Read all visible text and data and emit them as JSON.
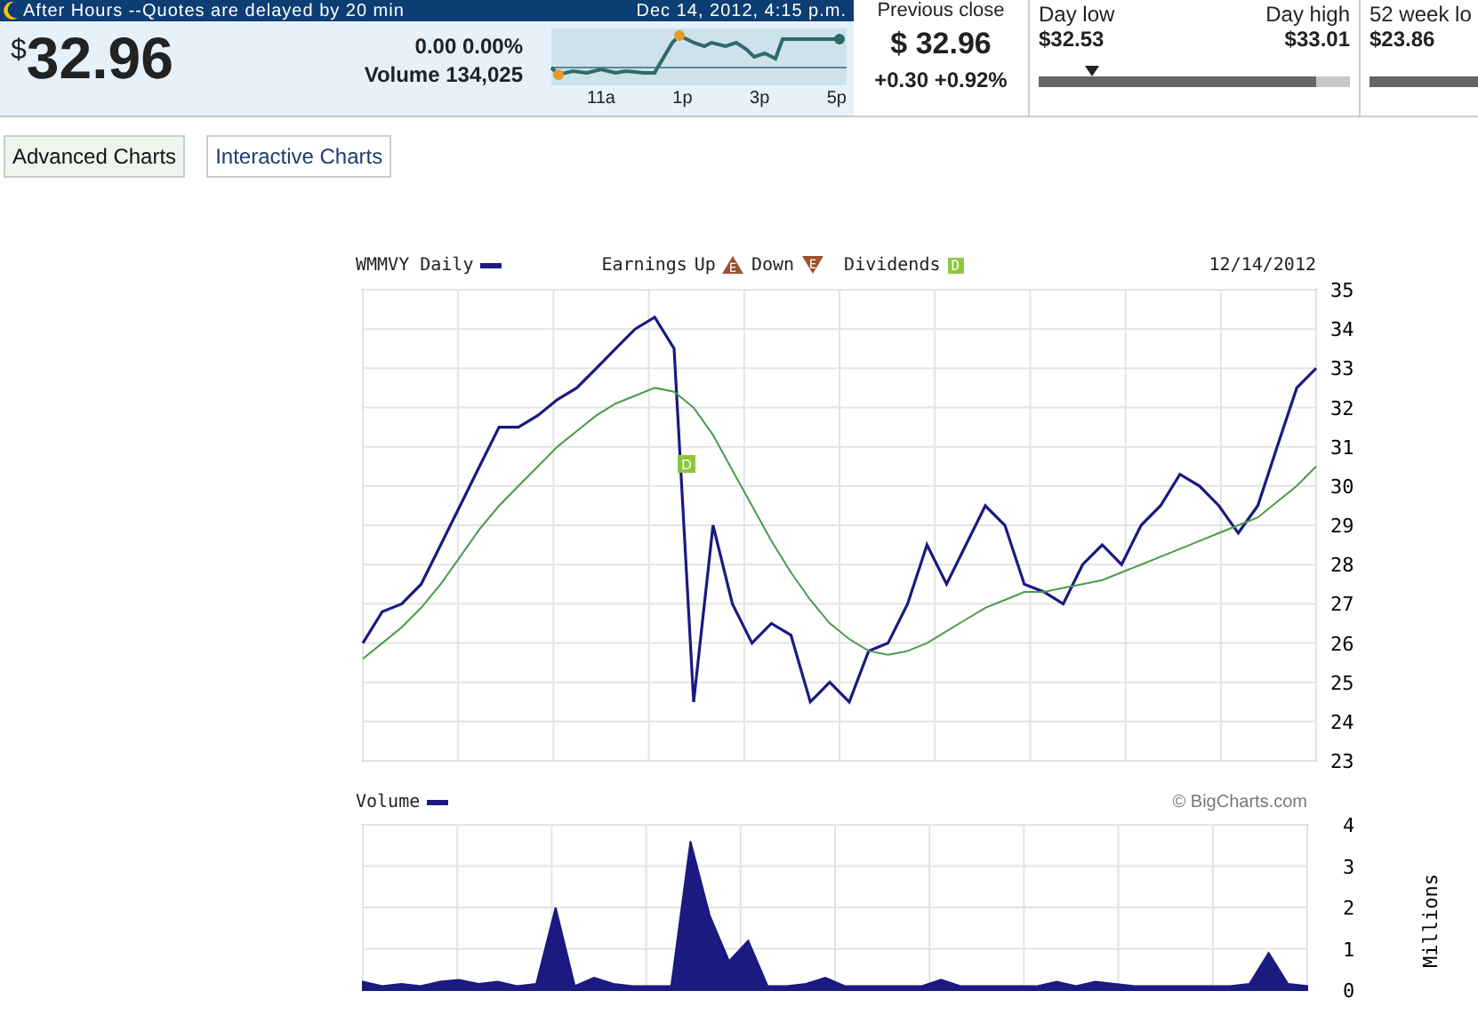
{
  "quote_header": {
    "notice": "After Hours --Quotes are delayed by 20 min",
    "timestamp": "Dec 14, 2012, 4:15 p.m.",
    "price_symbol": "$",
    "price": "32.96",
    "change": "0.00 0.00%",
    "volume": "Volume 134,025",
    "time_labels": [
      "11a",
      "1p",
      "3p",
      "5p"
    ]
  },
  "previous_close": {
    "label": "Previous close",
    "symbol": "$",
    "value": "32.96",
    "change": "+0.30 +0.92%"
  },
  "day_range": {
    "low_label": "Day low",
    "high_label": "Day high",
    "low": "$32.53",
    "high": "$33.01",
    "level": 0.89
  },
  "week_52": {
    "label": "52 week lo",
    "value": "$23.86"
  },
  "buttons": [
    {
      "label": "Advanced Charts",
      "selected": true
    },
    {
      "label": "Interactive Charts",
      "selected": false
    }
  ],
  "price_chart": {
    "legend": {
      "earnings": "Earnings",
      "up": "Up",
      "up_mark": "E",
      "down": "Down",
      "down_mark": "E",
      "dividends": "Dividends",
      "dividends_mark": "D",
      "date": "12/14/2012"
    },
    "chart_data": {
      "type": "line",
      "grid": true,
      "categories": [
        null,
        null,
        null,
        null,
        null,
        null,
        null,
        null,
        null,
        null,
        null,
        null,
        null,
        null,
        null,
        null,
        null,
        null,
        null,
        null,
        null,
        null,
        null,
        null,
        null,
        null,
        null,
        null,
        null,
        null,
        null,
        null,
        null,
        null,
        null,
        null,
        null,
        null,
        null,
        null,
        null,
        null,
        null,
        null,
        null,
        null,
        null,
        null,
        null,
        null
      ],
      "ylim": [
        23,
        35
      ],
      "yticks": [
        23,
        24,
        25,
        26,
        27,
        28,
        29,
        30,
        31,
        32,
        33,
        34,
        35
      ],
      "series": [
        {
          "name": "WMMVY Daily",
          "color": "#1a1a80",
          "values": [
            26,
            26.8,
            27,
            27.5,
            28.5,
            29.5,
            30.5,
            31.5,
            31.5,
            31.8,
            32.2,
            32.5,
            33,
            33.5,
            34,
            34.3,
            33.5,
            24.5,
            29,
            27,
            26,
            26.5,
            26.2,
            24.5,
            25,
            24.5,
            25.8,
            26,
            27,
            28.5,
            27.5,
            28.5,
            29.5,
            29,
            27.5,
            27.3,
            27,
            28,
            28.5,
            28,
            29,
            29.5,
            30.3,
            30,
            29.5,
            28.8,
            29.5,
            31,
            32.5,
            33
          ]
        },
        {
          "color": "#4a9a4a",
          "values": [
            25.6,
            26,
            26.4,
            26.9,
            27.5,
            28.2,
            28.9,
            29.5,
            30,
            30.5,
            31,
            31.4,
            31.8,
            32.1,
            32.3,
            32.5,
            32.4,
            32,
            31.3,
            30.4,
            29.5,
            28.6,
            27.8,
            27.1,
            26.5,
            26.1,
            25.8,
            25.7,
            25.8,
            26,
            26.3,
            26.6,
            26.9,
            27.1,
            27.3,
            27.3,
            27.4,
            27.5,
            27.6,
            27.8,
            28,
            28.2,
            28.4,
            28.6,
            28.8,
            29,
            29.2,
            29.6,
            30,
            30.5
          ]
        }
      ]
    },
    "dividend_marker": "D"
  },
  "volume_chart": {
    "credit": "© BigCharts.com",
    "chart_data": {
      "type": "area",
      "grid": true,
      "ylabel": "Millions",
      "categories": [
        null,
        null,
        null,
        null,
        null,
        null,
        null,
        null,
        null,
        null,
        null,
        null,
        null,
        null,
        null,
        null,
        null,
        null,
        null,
        null,
        null,
        null,
        null,
        null,
        null,
        null,
        null,
        null,
        null,
        null,
        null,
        null,
        null,
        null,
        null,
        null,
        null,
        null,
        null,
        null,
        null,
        null,
        null,
        null,
        null,
        null,
        null,
        null,
        null,
        null
      ],
      "ylim": [
        0,
        4
      ],
      "yticks": [
        0,
        1,
        2,
        3,
        4
      ],
      "series": [
        {
          "name": "Volume",
          "color": "#1a1a80",
          "values": [
            0.2,
            0.1,
            0.15,
            0.1,
            0.2,
            0.25,
            0.15,
            0.2,
            0.1,
            0.15,
            2.0,
            0.1,
            0.3,
            0.15,
            0.1,
            0.1,
            0.1,
            3.6,
            1.8,
            0.7,
            1.2,
            0.1,
            0.1,
            0.15,
            0.3,
            0.1,
            0.1,
            0.1,
            0.1,
            0.1,
            0.25,
            0.1,
            0.1,
            0.1,
            0.1,
            0.1,
            0.2,
            0.1,
            0.2,
            0.15,
            0.1,
            0.1,
            0.1,
            0.1,
            0.1,
            0.1,
            0.15,
            0.9,
            0.15,
            0.1
          ]
        }
      ]
    }
  }
}
